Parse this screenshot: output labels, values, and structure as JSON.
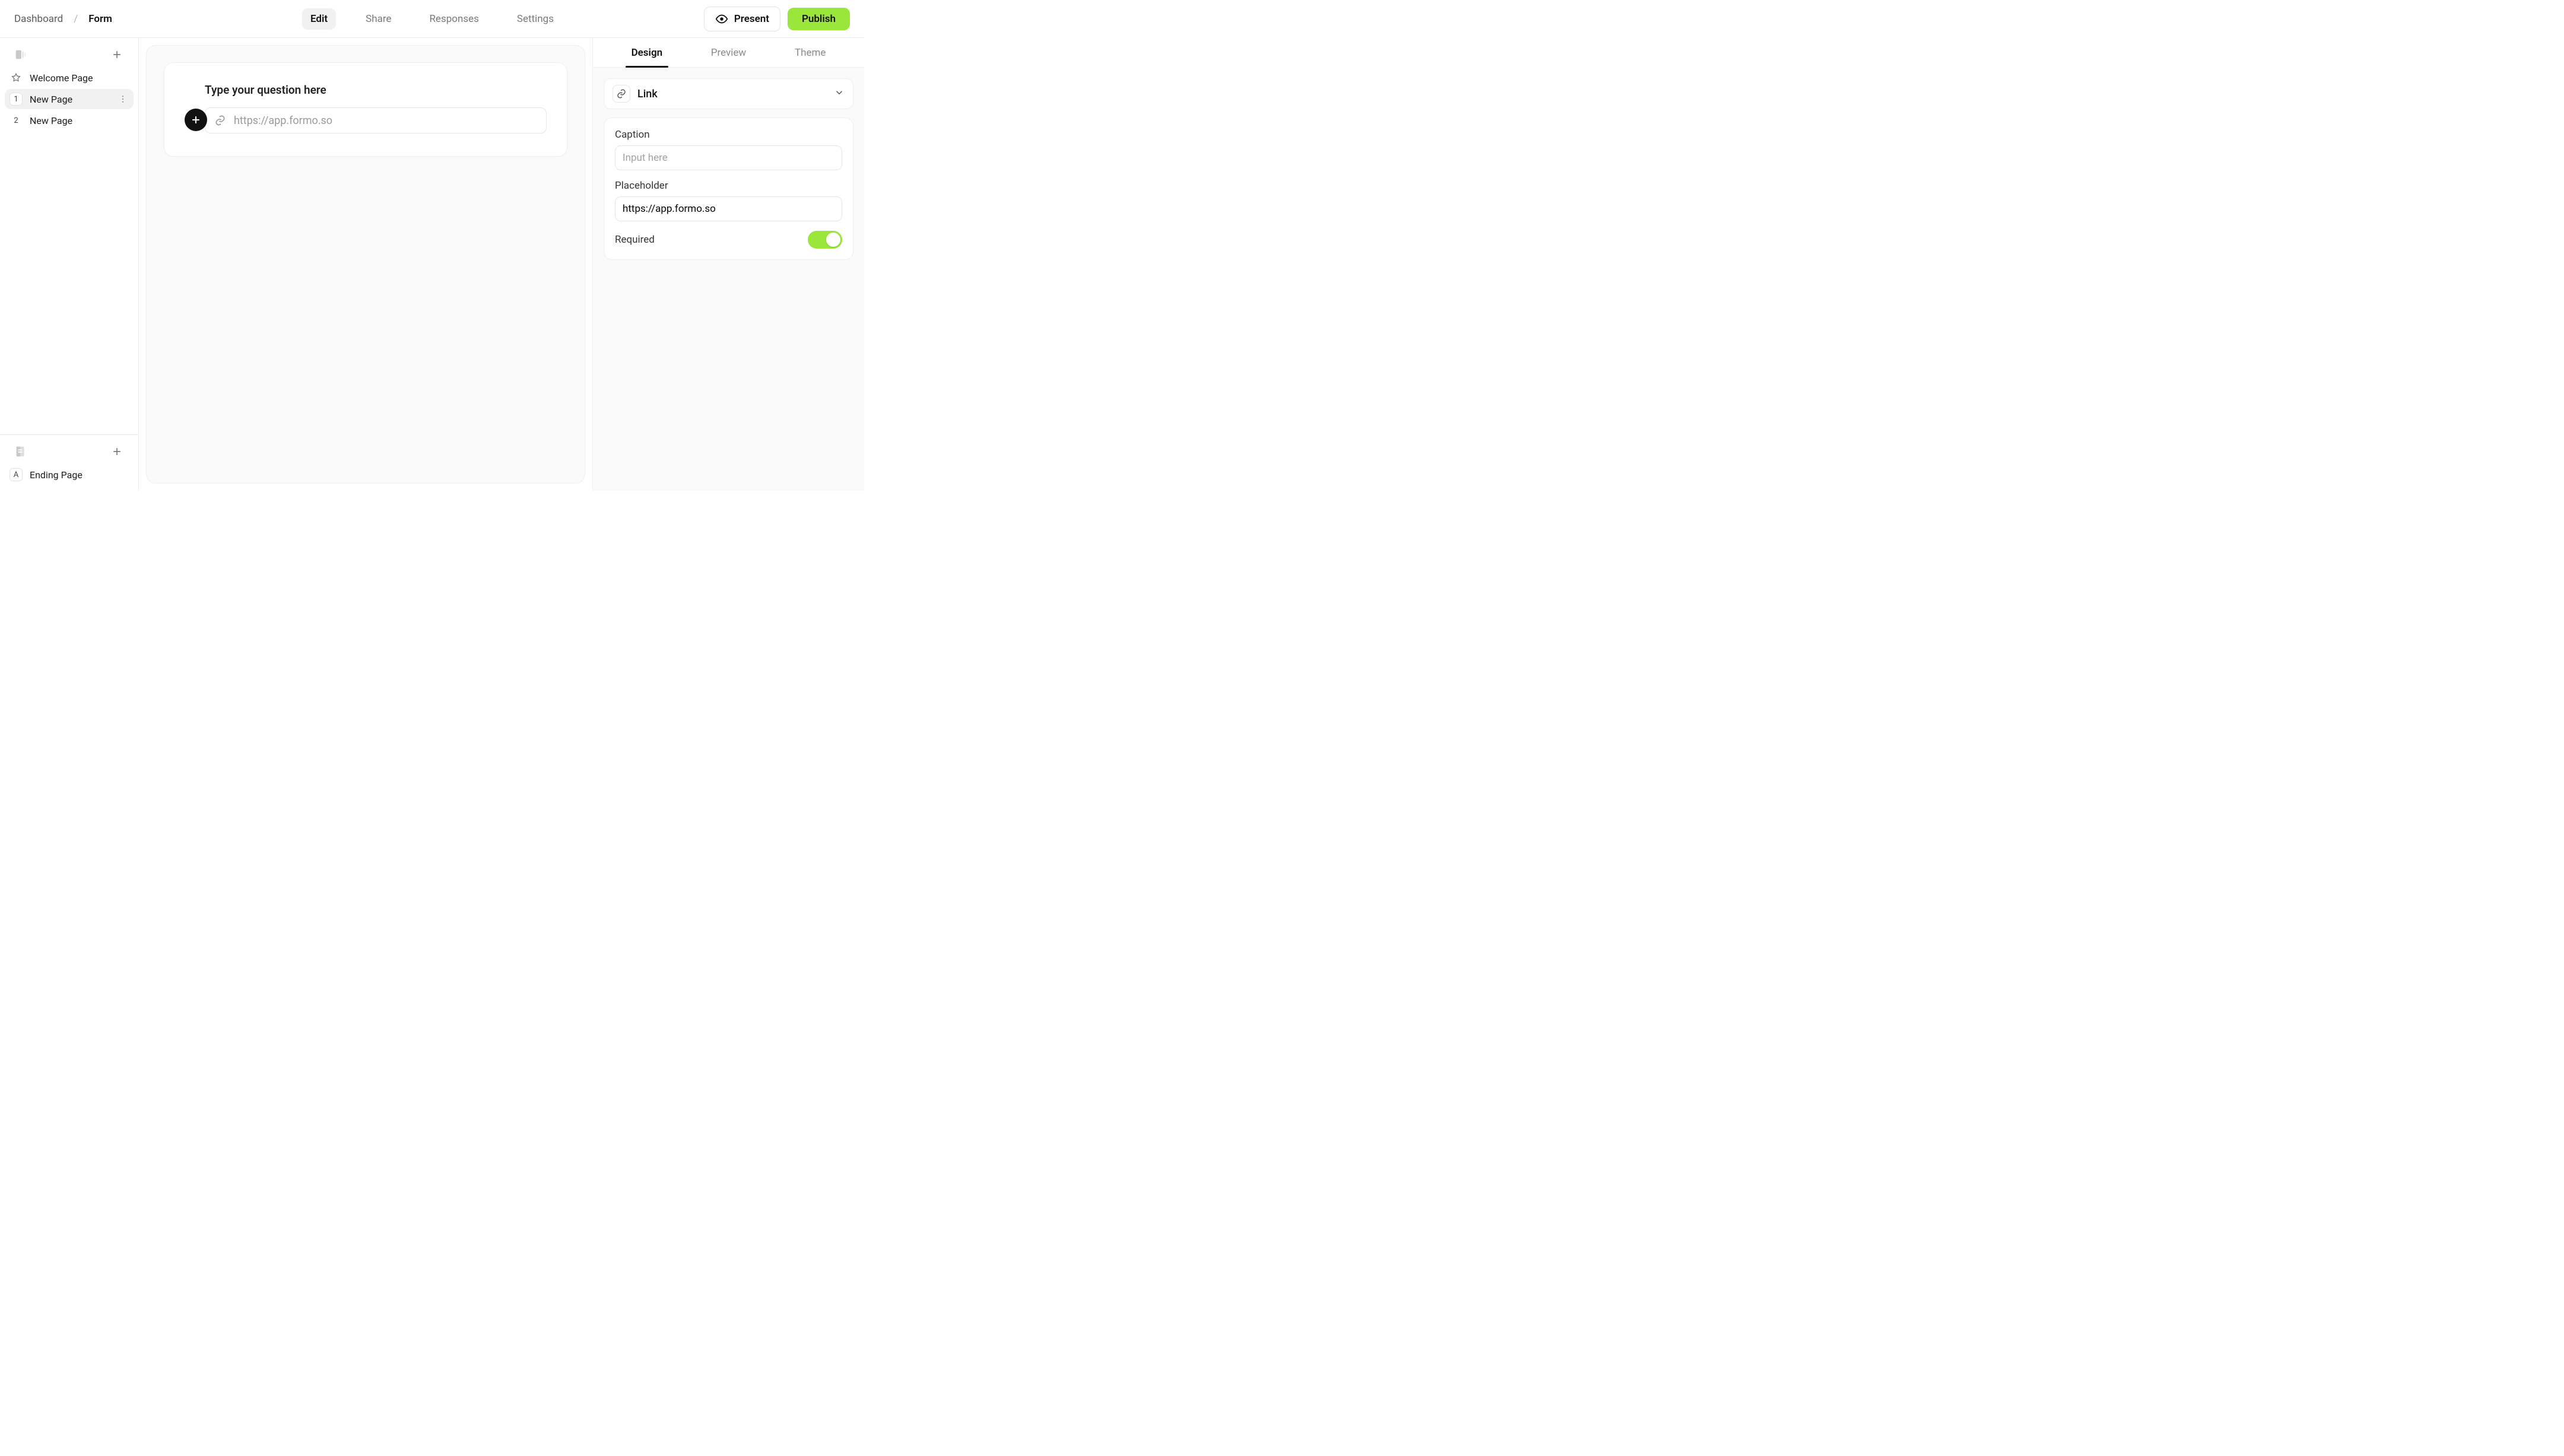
{
  "breadcrumb": {
    "dashboard": "Dashboard",
    "separator": "/",
    "current": "Form"
  },
  "tabs": {
    "edit": "Edit",
    "share": "Share",
    "responses": "Responses",
    "settings": "Settings"
  },
  "actions": {
    "present": "Present",
    "publish": "Publish"
  },
  "sidebar": {
    "main": {
      "welcome": {
        "label": "Welcome Page"
      },
      "items": [
        {
          "index": "1",
          "label": "New Page",
          "active": true
        },
        {
          "index": "2",
          "label": "New Page",
          "active": false
        }
      ]
    },
    "ending": {
      "items": [
        {
          "index": "A",
          "label": "Ending Page"
        }
      ]
    }
  },
  "canvas": {
    "question_placeholder": "Type your question here",
    "answer_placeholder": "https://app.formo.so"
  },
  "right": {
    "tabs": {
      "design": "Design",
      "preview": "Preview",
      "theme": "Theme"
    },
    "field_type": "Link",
    "caption_label": "Caption",
    "caption_placeholder": "Input here",
    "caption_value": "",
    "placeholder_label": "Placeholder",
    "placeholder_value": "https://app.formo.so",
    "required_label": "Required",
    "required_on": true
  }
}
